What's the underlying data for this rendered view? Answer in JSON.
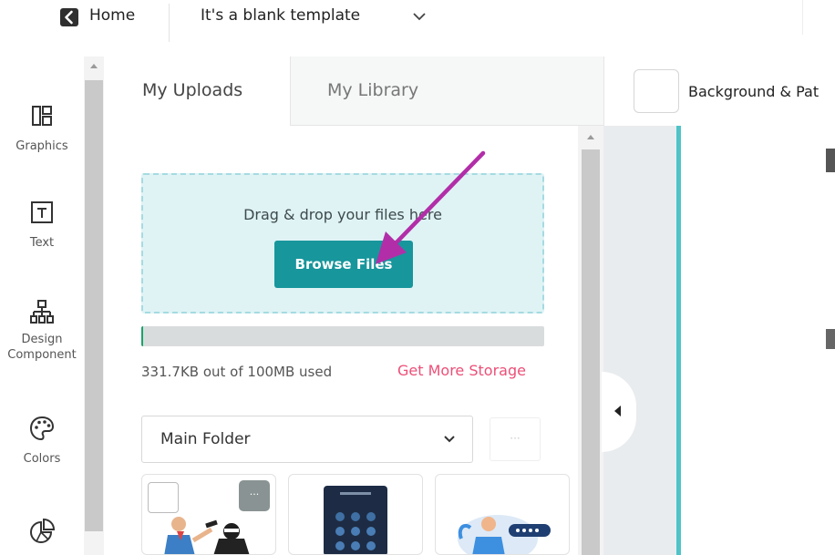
{
  "topbar": {
    "home_label": "Home",
    "template_title": "It's a blank template"
  },
  "rail": {
    "items": [
      {
        "label": "Graphics",
        "icon": "graphics-icon"
      },
      {
        "label": "Text",
        "icon": "text-icon"
      },
      {
        "label": "Design Component",
        "icon": "design-component-icon"
      },
      {
        "label": "Colors",
        "icon": "palette-icon"
      },
      {
        "label": "",
        "icon": "chart-icon"
      }
    ]
  },
  "panel": {
    "tabs": [
      {
        "label": "My Uploads",
        "active": true
      },
      {
        "label": "My Library",
        "active": false
      }
    ],
    "dropzone_text": "Drag & drop your files here",
    "browse_label": "Browse Files",
    "storage_used_fraction": 0.003,
    "storage_text": "331.7KB out of 100MB used",
    "storage_link": "Get More Storage",
    "folder_selected": "Main Folder",
    "more_label": "···",
    "thumb_menu_label": "···"
  },
  "canvas": {
    "background_label": "Background & Pat"
  },
  "colors": {
    "accent": "#17969c",
    "link": "#ec4f77",
    "dropzone_bg": "#dff3f5",
    "pointer_arrow": "#b22ea8"
  }
}
